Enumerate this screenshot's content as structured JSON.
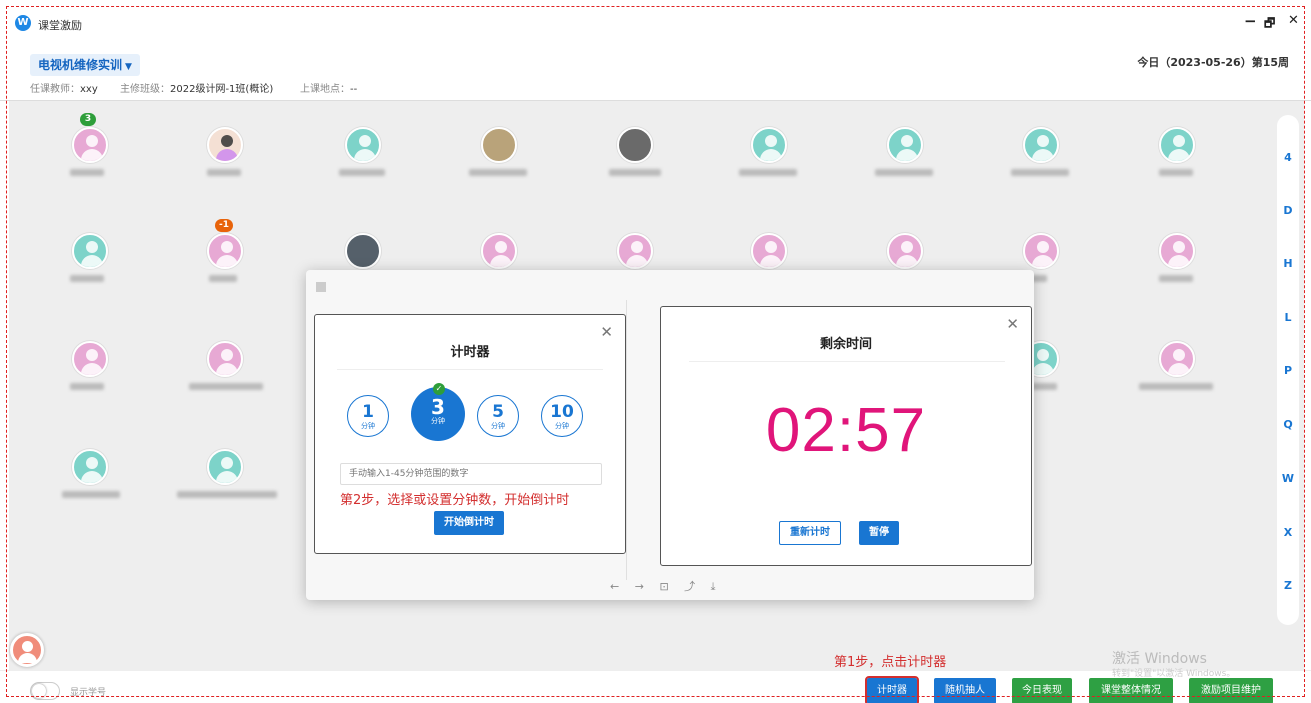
{
  "window": {
    "app_logo": "W",
    "title": "课堂激励",
    "minimize": "−",
    "restore": "🗗",
    "close": "✕"
  },
  "header": {
    "course_name": "电视机维修实训",
    "teacher_label": "任课教师：",
    "teacher_value": "xxy",
    "class_label": "主修班级：",
    "class_value": "2022级计网-1班(概论)",
    "location_label": "上课地点：",
    "location_value": "--",
    "date_text": "今日（2023-05-26）第15周"
  },
  "badges": {
    "student_1": "3",
    "student_11": "-1"
  },
  "index_letters": [
    "4",
    "D",
    "H",
    "L",
    "P",
    "Q",
    "W",
    "X",
    "Z"
  ],
  "timer_setup": {
    "title": "计时器",
    "options": [
      {
        "num": "1",
        "unit": "分钟"
      },
      {
        "num": "3",
        "unit": "分钟"
      },
      {
        "num": "5",
        "unit": "分钟"
      },
      {
        "num": "10",
        "unit": "分钟"
      }
    ],
    "selected_index": 1,
    "input_placeholder": "手动输入1-45分钟范围的数字",
    "step2_text": "第2步，选择或设置分钟数，开始倒计时",
    "start_button": "开始倒计时",
    "close": "✕"
  },
  "countdown": {
    "title": "剩余时间",
    "time": "02:57",
    "reset_button": "重新计时",
    "pause_button": "暂停",
    "close": "✕"
  },
  "viewer_toolbar": {
    "prev": "←",
    "next": "→",
    "fit": "⊡",
    "rotate": "⤴",
    "download": "⤓"
  },
  "footer": {
    "show_id_label": "显示学号",
    "step1_text": "第1步，点击计时器",
    "buttons": {
      "timer": "计时器",
      "random_pick": "随机抽人",
      "today_perf": "今日表现",
      "class_overall": "课堂整体情况",
      "incentive_maint": "激励项目维护"
    }
  },
  "watermark": {
    "line1": "激活 Windows",
    "line2": "转到\"设置\"以激活 Windows。"
  },
  "colors": {
    "accent": "#1976d2",
    "countdown": "#e0157a",
    "annotation": "#d32f2f",
    "green": "#2ea043"
  }
}
